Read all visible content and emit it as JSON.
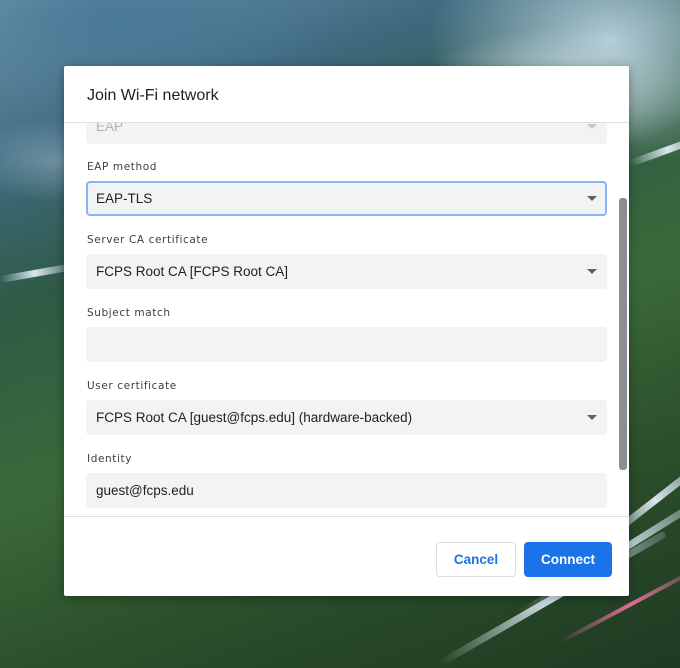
{
  "dialog": {
    "title": "Join Wi-Fi network"
  },
  "fields": {
    "security": {
      "value": "EAP"
    },
    "eap_method": {
      "label": "EAP method",
      "value": "EAP-TLS"
    },
    "server_ca": {
      "label": "Server CA certificate",
      "value": "FCPS Root CA [FCPS Root CA]"
    },
    "subject_match": {
      "label": "Subject match",
      "value": ""
    },
    "user_cert": {
      "label": "User certificate",
      "value": "FCPS Root CA [guest@fcps.edu] (hardware-backed)"
    },
    "identity": {
      "label": "Identity",
      "value": "guest@fcps.edu"
    }
  },
  "buttons": {
    "cancel_label": "Cancel",
    "connect_label": "Connect"
  },
  "icons": {
    "dropdown": "chevron-down-icon"
  },
  "colors": {
    "accent": "#1a73e8",
    "focus_ring": "#8ab4f8",
    "field_bg": "#f1f3f4"
  }
}
